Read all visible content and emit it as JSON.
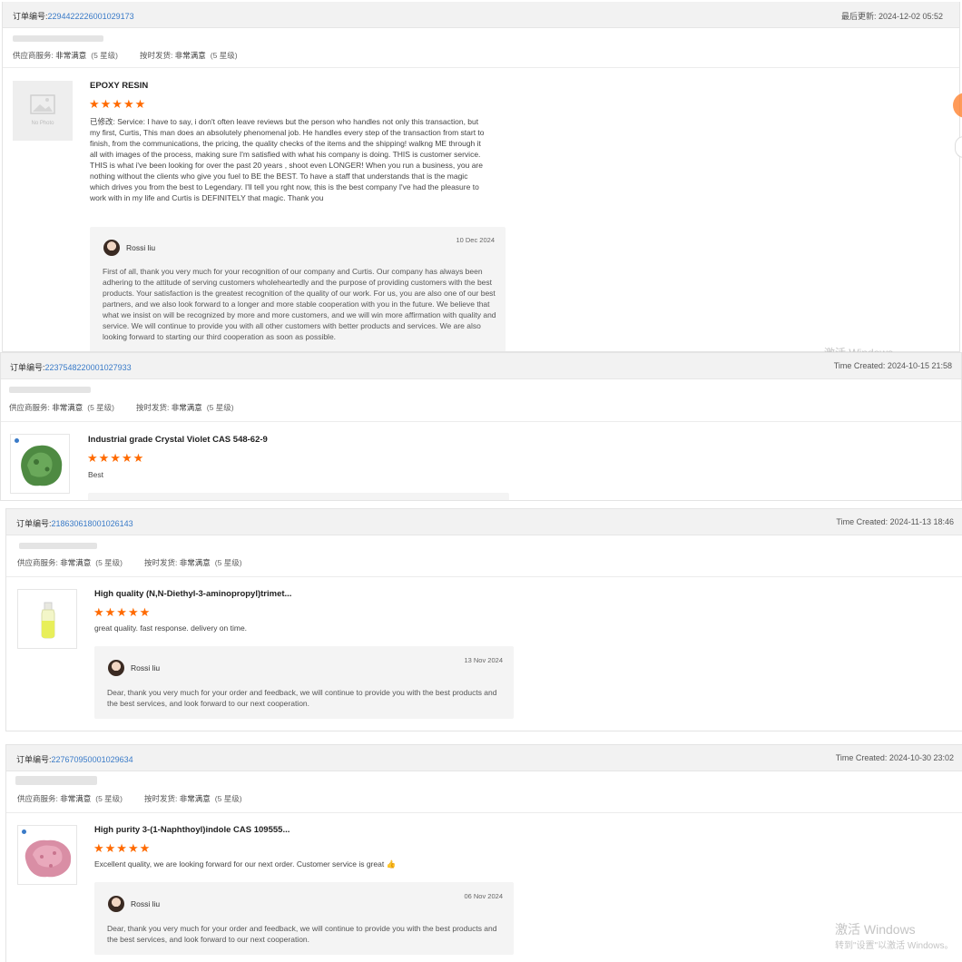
{
  "labels": {
    "order_prefix": "订单编号:",
    "supplier_service": "供应商服务:",
    "ontime": "按时发货:",
    "very_satisfied": "非常满意",
    "five_star": "(5 星级)",
    "no_photo": "No Photo"
  },
  "cards": [
    {
      "order_num": "2294422226001029173",
      "time_text": "最后更新:  2024-12-02 05:52",
      "title": "EPOXY RESIN",
      "stars": "★★★★★",
      "review": "已修改: Service:   I have to say, i don't often leave reviews but the person who handles not only this transaction, but my first, Curtis, This man does an absolutely phenomenal job. He handles every step of the transaction from start to finish, from the communications, the pricing, the quality checks of the items and the shipping! walkng ME through it all with images of the process, making sure I'm satisfied with what his company is doing. THIS is customer service. THIS is what i've been looking for over the past 20 years , shoot even LONGER!  When you run a business, you are nothing without the clients who give you fuel to BE the BEST. To have a staff that understands that is the magic which drives you from the best to Legendary. I'll tell you rght now, this is the best company I've had the pleasure to work with in my life and Curtis is DEFINITELY that magic.  Thank you",
      "reply_name": "Rossi liu",
      "reply_date": "10 Dec 2024",
      "reply_text": "First of all, thank you very much for your recognition of our company and Curtis. Our company has always been adhering to the attitude of serving customers wholeheartedly and the purpose of providing customers with the best products. Your satisfaction is the greatest recognition of the quality of our work. For us, you are also one of our best partners, and we also look forward to a longer and more stable cooperation with you in the future. We believe that what we insist on will be recognized by more and more customers, and we will win more affirmation with quality and service. We will continue to provide you with all other customers with better products and services. We are also looking forward to starting our third cooperation as soon as possible."
    },
    {
      "order_num": "2237548220001027933",
      "time_text": "Time Created: 2024-10-15 21:58",
      "title": "Industrial grade Crystal Violet CAS 548-62-9",
      "stars": "★★★★★",
      "review": "Best"
    },
    {
      "order_num": "218630618001026143",
      "time_text": "Time Created: 2024-11-13 18:46",
      "title": "High quality (N,N-Diethyl-3-aminopropyl)trimet...",
      "stars": "★★★★★",
      "review": "great quality. fast response. delivery on time.",
      "reply_name": "Rossi liu",
      "reply_date": "13 Nov 2024",
      "reply_text": "Dear, thank you very much for your order and feedback, we will continue to provide you with the best products and the best services, and look forward to our next cooperation."
    },
    {
      "order_num": "227670950001029634",
      "time_text": "Time Created: 2024-10-30 23:02",
      "title": "High purity 3-(1-Naphthoyl)indole CAS 109555...",
      "stars": "★★★★★",
      "review": "Excellent quality, we are looking forward for our next order. Customer service is great 👍",
      "reply_name": "Rossi liu",
      "reply_date": "06 Nov 2024",
      "reply_text": "Dear, thank you very much for your order and feedback, we will continue to provide you with the best products and the best services, and look forward to our next cooperation."
    }
  ],
  "watermark": {
    "line1": "激活 Windows",
    "line2": "转到\"设置\"以激活 Windows。",
    "partial": "激活 Windows"
  },
  "colors": {
    "star": "#ff6a00",
    "link": "#3a7bc8"
  }
}
